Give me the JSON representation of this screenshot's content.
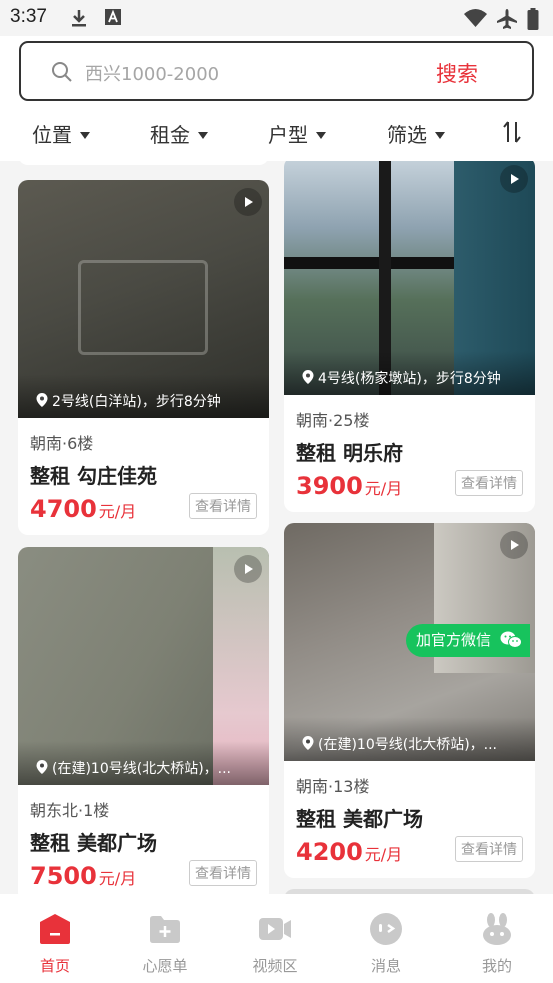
{
  "status": {
    "time": "3:37"
  },
  "search": {
    "placeholder": "西兴1000-2000",
    "button": "搜索"
  },
  "filters": [
    "位置",
    "租金",
    "户型",
    "筛选"
  ],
  "cards": [
    {
      "location": "2号线(白洋站)，步行8分钟",
      "orientation": "朝南·6楼",
      "title": "整租 勾庄佳苑",
      "price": "4700",
      "unit": "元/月",
      "detail": "查看详情"
    },
    {
      "location": "4号线(杨家墩站)，步行8分钟",
      "orientation": "朝南·25楼",
      "title": "整租 明乐府",
      "price": "3900",
      "unit": "元/月",
      "detail": "查看详情"
    },
    {
      "location": "(在建)10号线(北大桥站)，...",
      "orientation": "朝东北·1楼",
      "title": "整租 美都广场",
      "price": "7500",
      "unit": "元/月",
      "detail": "查看详情"
    },
    {
      "location": "(在建)10号线(北大桥站)，...",
      "orientation": "朝南·13楼",
      "title": "整租 美都广场",
      "price": "4200",
      "unit": "元/月",
      "detail": "查看详情",
      "badge": "加官方微信"
    }
  ],
  "tabs": [
    {
      "label": "首页",
      "icon": "home-icon",
      "active": true
    },
    {
      "label": "心愿单",
      "icon": "wishlist-icon"
    },
    {
      "label": "视频区",
      "icon": "video-icon"
    },
    {
      "label": "消息",
      "icon": "message-icon"
    },
    {
      "label": "我的",
      "icon": "profile-icon"
    }
  ],
  "colors": {
    "accent": "#e8323a",
    "wechat": "#17c35d"
  }
}
